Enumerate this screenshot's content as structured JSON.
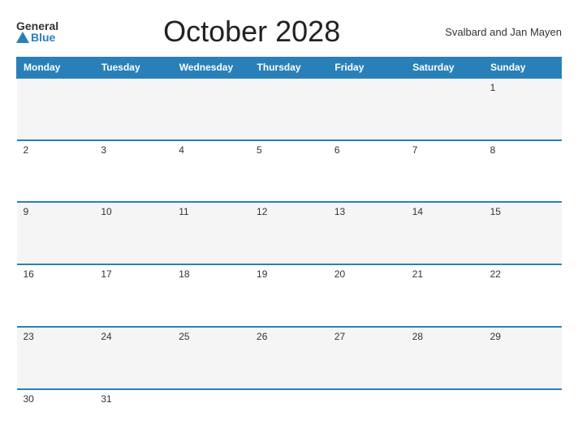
{
  "header": {
    "logo_general": "General",
    "logo_blue": "Blue",
    "title": "October 2028",
    "region": "Svalbard and Jan Mayen"
  },
  "weekdays": [
    "Monday",
    "Tuesday",
    "Wednesday",
    "Thursday",
    "Friday",
    "Saturday",
    "Sunday"
  ],
  "weeks": [
    [
      "",
      "",
      "",
      "",
      "",
      "",
      "1"
    ],
    [
      "2",
      "3",
      "4",
      "5",
      "6",
      "7",
      "8"
    ],
    [
      "9",
      "10",
      "11",
      "12",
      "13",
      "14",
      "15"
    ],
    [
      "16",
      "17",
      "18",
      "19",
      "20",
      "21",
      "22"
    ],
    [
      "23",
      "24",
      "25",
      "26",
      "27",
      "28",
      "29"
    ],
    [
      "30",
      "31",
      "",
      "",
      "",
      "",
      ""
    ]
  ]
}
